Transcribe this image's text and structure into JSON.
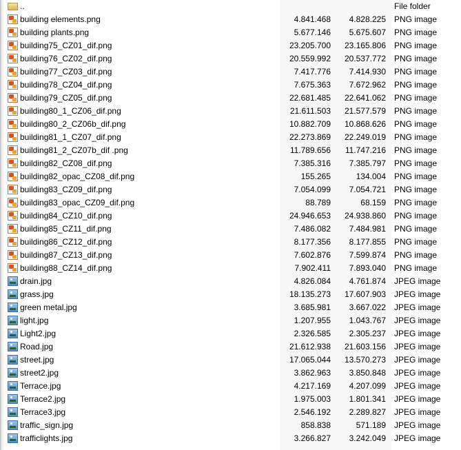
{
  "parent_row": {
    "name": "..",
    "type": "File folder"
  },
  "files": [
    {
      "name": "building elements.png",
      "size": "4.841.468",
      "packed": "4.828.225",
      "type": "PNG image",
      "kind": "png"
    },
    {
      "name": "building plants.png",
      "size": "5.677.146",
      "packed": "5.675.607",
      "type": "PNG image",
      "kind": "png"
    },
    {
      "name": "building75_CZ01_dif.png",
      "size": "23.205.700",
      "packed": "23.165.806",
      "type": "PNG image",
      "kind": "png"
    },
    {
      "name": "building76_CZ02_dif.png",
      "size": "20.559.992",
      "packed": "20.537.772",
      "type": "PNG image",
      "kind": "png"
    },
    {
      "name": "building77_CZ03_dif.png",
      "size": "7.417.776",
      "packed": "7.414.930",
      "type": "PNG image",
      "kind": "png"
    },
    {
      "name": "building78_CZ04_dif.png",
      "size": "7.675.363",
      "packed": "7.672.962",
      "type": "PNG image",
      "kind": "png"
    },
    {
      "name": "building79_CZ05_dif.png",
      "size": "22.681.485",
      "packed": "22.641.062",
      "type": "PNG image",
      "kind": "png"
    },
    {
      "name": "building80_1_CZ06_dif.png",
      "size": "21.611.503",
      "packed": "21.577.579",
      "type": "PNG image",
      "kind": "png"
    },
    {
      "name": "building80_2_CZ06b_dif.png",
      "size": "10.882.709",
      "packed": "10.868.626",
      "type": "PNG image",
      "kind": "png"
    },
    {
      "name": "building81_1_CZ07_dif.png",
      "size": "22.273.869",
      "packed": "22.249.019",
      "type": "PNG image",
      "kind": "png"
    },
    {
      "name": "building81_2_CZ07b_dif .png",
      "size": "11.789.656",
      "packed": "11.747.216",
      "type": "PNG image",
      "kind": "png"
    },
    {
      "name": "building82_CZ08_dif.png",
      "size": "7.385.316",
      "packed": "7.385.797",
      "type": "PNG image",
      "kind": "png"
    },
    {
      "name": "building82_opac_CZ08_dif.png",
      "size": "155.265",
      "packed": "134.004",
      "type": "PNG image",
      "kind": "png"
    },
    {
      "name": "building83_CZ09_dif.png",
      "size": "7.054.099",
      "packed": "7.054.721",
      "type": "PNG image",
      "kind": "png"
    },
    {
      "name": "building83_opac_CZ09_dif.png",
      "size": "88.789",
      "packed": "68.159",
      "type": "PNG image",
      "kind": "png"
    },
    {
      "name": "building84_CZ10_dif.png",
      "size": "24.946.653",
      "packed": "24.938.860",
      "type": "PNG image",
      "kind": "png"
    },
    {
      "name": "building85_CZ11_dif.png",
      "size": "7.486.082",
      "packed": "7.484.981",
      "type": "PNG image",
      "kind": "png"
    },
    {
      "name": "building86_CZ12_dif.png",
      "size": "8.177.356",
      "packed": "8.177.855",
      "type": "PNG image",
      "kind": "png"
    },
    {
      "name": "building87_CZ13_dif.png",
      "size": "7.602.876",
      "packed": "7.599.874",
      "type": "PNG image",
      "kind": "png"
    },
    {
      "name": "building88_CZ14_dif.png",
      "size": "7.902.411",
      "packed": "7.893.040",
      "type": "PNG image",
      "kind": "png"
    },
    {
      "name": "drain.jpg",
      "size": "4.826.084",
      "packed": "4.761.874",
      "type": "JPEG image",
      "kind": "jpg"
    },
    {
      "name": "grass.jpg",
      "size": "18.135.273",
      "packed": "17.607.903",
      "type": "JPEG image",
      "kind": "jpg"
    },
    {
      "name": "green metal.jpg",
      "size": "3.685.981",
      "packed": "3.667.022",
      "type": "JPEG image",
      "kind": "jpg"
    },
    {
      "name": "light.jpg",
      "size": "1.207.955",
      "packed": "1.043.767",
      "type": "JPEG image",
      "kind": "jpg"
    },
    {
      "name": "Light2.jpg",
      "size": "2.326.585",
      "packed": "2.305.237",
      "type": "JPEG image",
      "kind": "jpg"
    },
    {
      "name": "Road.jpg",
      "size": "21.612.938",
      "packed": "21.603.156",
      "type": "JPEG image",
      "kind": "jpg"
    },
    {
      "name": "street.jpg",
      "size": "17.065.044",
      "packed": "13.570.273",
      "type": "JPEG image",
      "kind": "jpg"
    },
    {
      "name": "street2.jpg",
      "size": "3.862.963",
      "packed": "3.850.848",
      "type": "JPEG image",
      "kind": "jpg"
    },
    {
      "name": "Terrace.jpg",
      "size": "4.217.169",
      "packed": "4.207.099",
      "type": "JPEG image",
      "kind": "jpg"
    },
    {
      "name": "Terrace2.jpg",
      "size": "1.975.003",
      "packed": "1.801.341",
      "type": "JPEG image",
      "kind": "jpg"
    },
    {
      "name": "Terrace3.jpg",
      "size": "2.546.192",
      "packed": "2.289.827",
      "type": "JPEG image",
      "kind": "jpg"
    },
    {
      "name": "traffic_sign.jpg",
      "size": "858.838",
      "packed": "571.189",
      "type": "JPEG image",
      "kind": "jpg"
    },
    {
      "name": "trafficlights.jpg",
      "size": "3.266.827",
      "packed": "3.242.049",
      "type": "JPEG image",
      "kind": "jpg"
    }
  ],
  "icons": {
    "png": "png-file-icon",
    "jpg": "jpeg-file-icon",
    "folder": "folder-icon"
  }
}
